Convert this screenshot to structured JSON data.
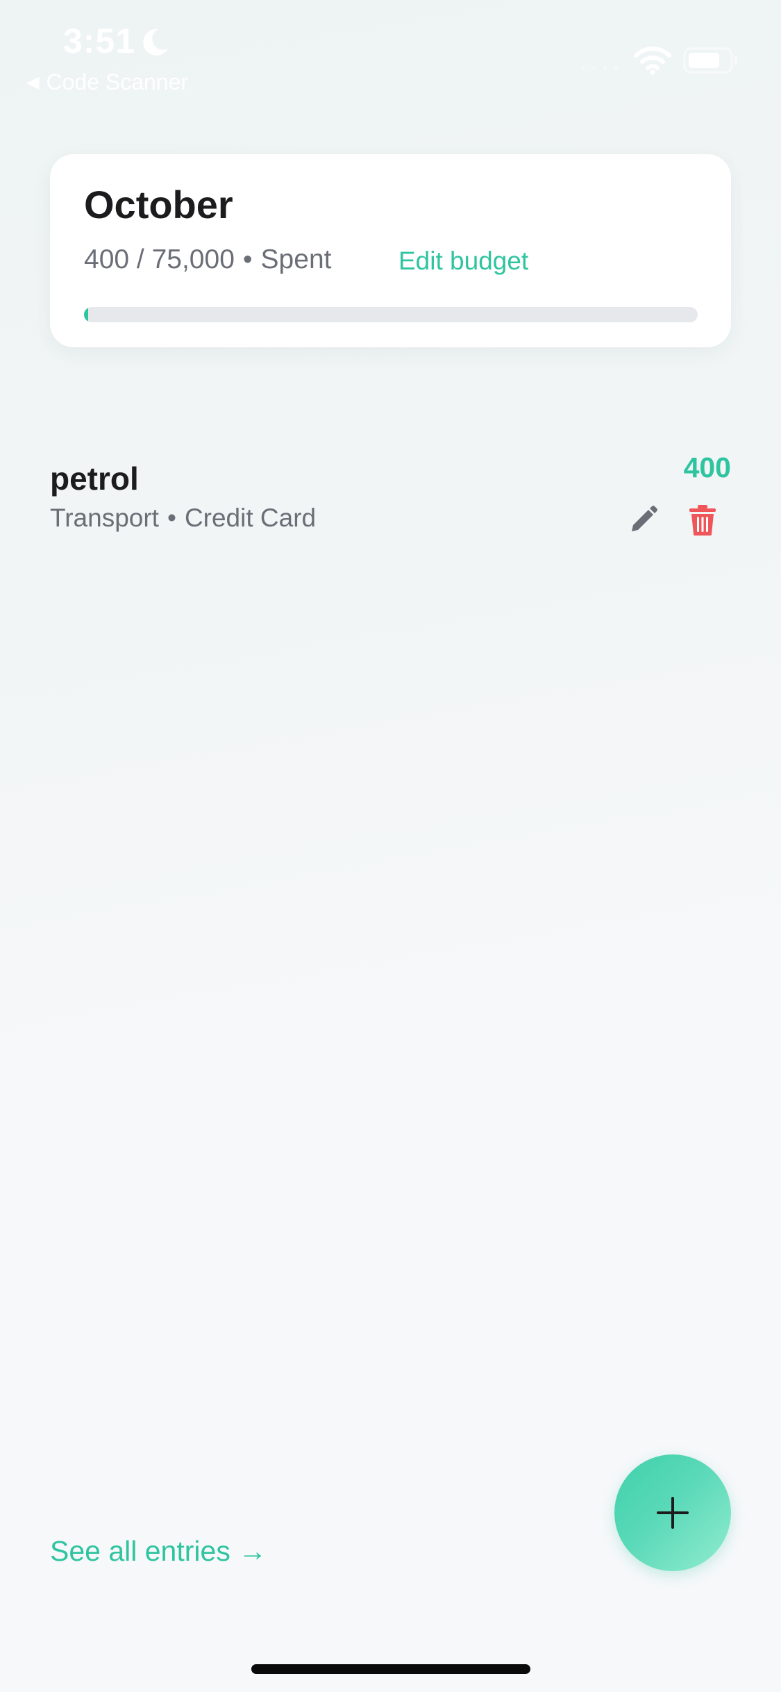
{
  "status_bar": {
    "time": "3:51",
    "back_label": "Code Scanner",
    "back_arrow": "◀"
  },
  "budget": {
    "month": "October",
    "spent": "400",
    "separator_slash": " / ",
    "total": "75,000",
    "dot": "•",
    "spent_label": "Spent",
    "edit_label": "Edit budget",
    "progress_fraction": 0.0053
  },
  "expenses": [
    {
      "name": "petrol",
      "category": "Transport",
      "dot": "•",
      "payment_method": "Credit Card",
      "amount": "400"
    }
  ],
  "footer": {
    "see_all_label": "See all entries →"
  },
  "colors": {
    "accent": "#2fc4a0",
    "delete": "#f0555a",
    "muted_text": "#6b6e76",
    "track": "#e6e8ec"
  },
  "icons": {
    "moon": "moon-icon",
    "wifi": "wifi-icon",
    "battery": "battery-icon",
    "edit": "pencil-icon",
    "delete": "trash-icon",
    "add": "plus-icon"
  }
}
